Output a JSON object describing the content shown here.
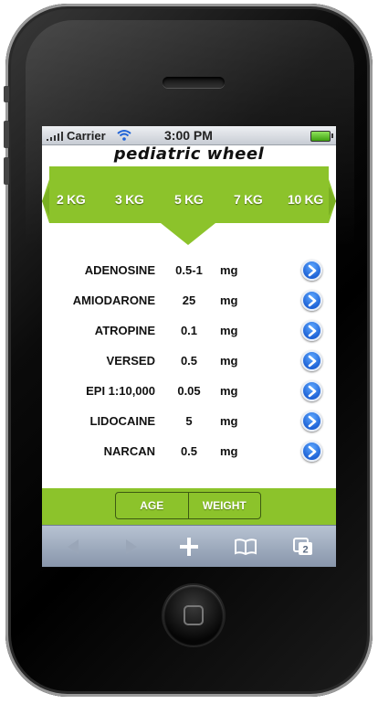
{
  "status": {
    "carrier": "Carrier",
    "time": "3:00 PM"
  },
  "app": {
    "title": "pediatric wheel"
  },
  "weights": [
    "2 KG",
    "3 KG",
    "5 KG",
    "7 KG",
    "10 KG"
  ],
  "drugs": [
    {
      "name": "ADENOSINE",
      "dose": "0.5-1",
      "unit": "mg"
    },
    {
      "name": "AMIODARONE",
      "dose": "25",
      "unit": "mg"
    },
    {
      "name": "ATROPINE",
      "dose": "0.1",
      "unit": "mg"
    },
    {
      "name": "VERSED",
      "dose": "0.5",
      "unit": "mg"
    },
    {
      "name": "EPI 1:10,000",
      "dose": "0.05",
      "unit": "mg"
    },
    {
      "name": "LIDOCAINE",
      "dose": "5",
      "unit": "mg"
    },
    {
      "name": "NARCAN",
      "dose": "0.5",
      "unit": "mg"
    }
  ],
  "segments": {
    "age": "AGE",
    "weight": "WEIGHT"
  },
  "toolbar": {
    "tabs_count": "2"
  },
  "colors": {
    "accent_green": "#8cc32b",
    "detail_blue": "#1f63d6"
  },
  "icons": [
    "signal-icon",
    "wifi-icon",
    "battery-icon",
    "chevron-right-icon",
    "back-icon",
    "forward-icon",
    "add-icon",
    "bookmarks-icon",
    "tabs-icon"
  ]
}
